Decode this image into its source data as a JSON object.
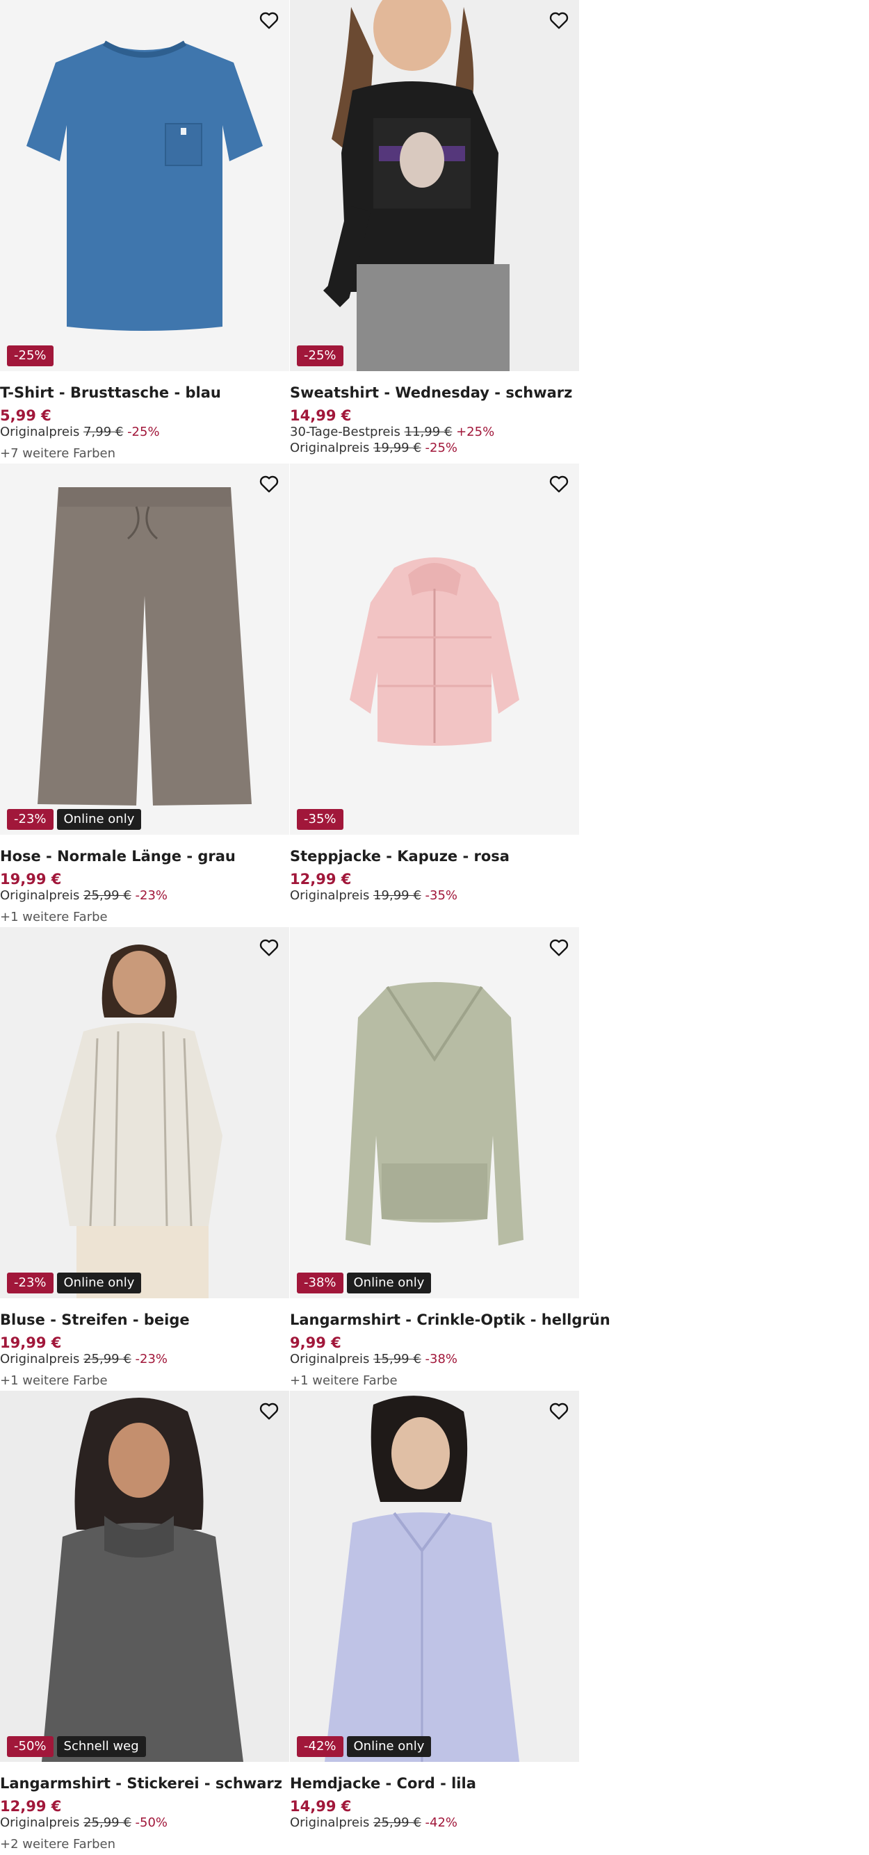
{
  "icons": {
    "favorite": "heart-outline-icon"
  },
  "colors": {
    "sale": "#a1173a",
    "badge_dark": "#1e1e1e",
    "image_bg": "#f3f3f3"
  },
  "products": [
    {
      "title": "T-Shirt - Brusttasche - blau",
      "price": "5,99 €",
      "badges": [
        "-25%"
      ],
      "lines": [
        {
          "label": "Originalpreis",
          "old": "7,99 €",
          "pct": "-25%"
        }
      ],
      "more_colors": "+7 weitere Farben"
    },
    {
      "title": "Sweatshirt - Wednesday - schwarz",
      "price": "14,99 €",
      "badges": [
        "-25%"
      ],
      "lines": [
        {
          "label": "30-Tage-Bestpreis",
          "old": "11,99 €",
          "pct": "+25%"
        },
        {
          "label": "Originalpreis",
          "old": "19,99 €",
          "pct": "-25%"
        }
      ],
      "more_colors": ""
    },
    {
      "title": "Hose - Normale Länge - grau",
      "price": "19,99 €",
      "badges": [
        "-23%",
        "Online only"
      ],
      "lines": [
        {
          "label": "Originalpreis",
          "old": "25,99 €",
          "pct": "-23%"
        }
      ],
      "more_colors": "+1 weitere Farbe"
    },
    {
      "title": "Steppjacke - Kapuze - rosa",
      "price": "12,99 €",
      "badges": [
        "-35%"
      ],
      "lines": [
        {
          "label": "Originalpreis",
          "old": "19,99 €",
          "pct": "-35%"
        }
      ],
      "more_colors": ""
    },
    {
      "title": "Bluse - Streifen - beige",
      "price": "19,99 €",
      "badges": [
        "-23%",
        "Online only"
      ],
      "lines": [
        {
          "label": "Originalpreis",
          "old": "25,99 €",
          "pct": "-23%"
        }
      ],
      "more_colors": "+1 weitere Farbe"
    },
    {
      "title": "Langarmshirt - Crinkle-Optik - hellgrün",
      "price": "9,99 €",
      "badges": [
        "-38%",
        "Online only"
      ],
      "lines": [
        {
          "label": "Originalpreis",
          "old": "15,99 €",
          "pct": "-38%"
        }
      ],
      "more_colors": "+1 weitere Farbe"
    },
    {
      "title": "Langarmshirt - Stickerei - schwarz",
      "price": "12,99 €",
      "badges": [
        "-50%",
        "Schnell weg"
      ],
      "lines": [
        {
          "label": "Originalpreis",
          "old": "25,99 €",
          "pct": "-50%"
        }
      ],
      "more_colors": "+2 weitere Farben"
    },
    {
      "title": "Hemdjacke - Cord - lila",
      "price": "14,99 €",
      "badges": [
        "-42%",
        "Online only"
      ],
      "lines": [
        {
          "label": "Originalpreis",
          "old": "25,99 €",
          "pct": "-42%"
        }
      ],
      "more_colors": ""
    }
  ]
}
